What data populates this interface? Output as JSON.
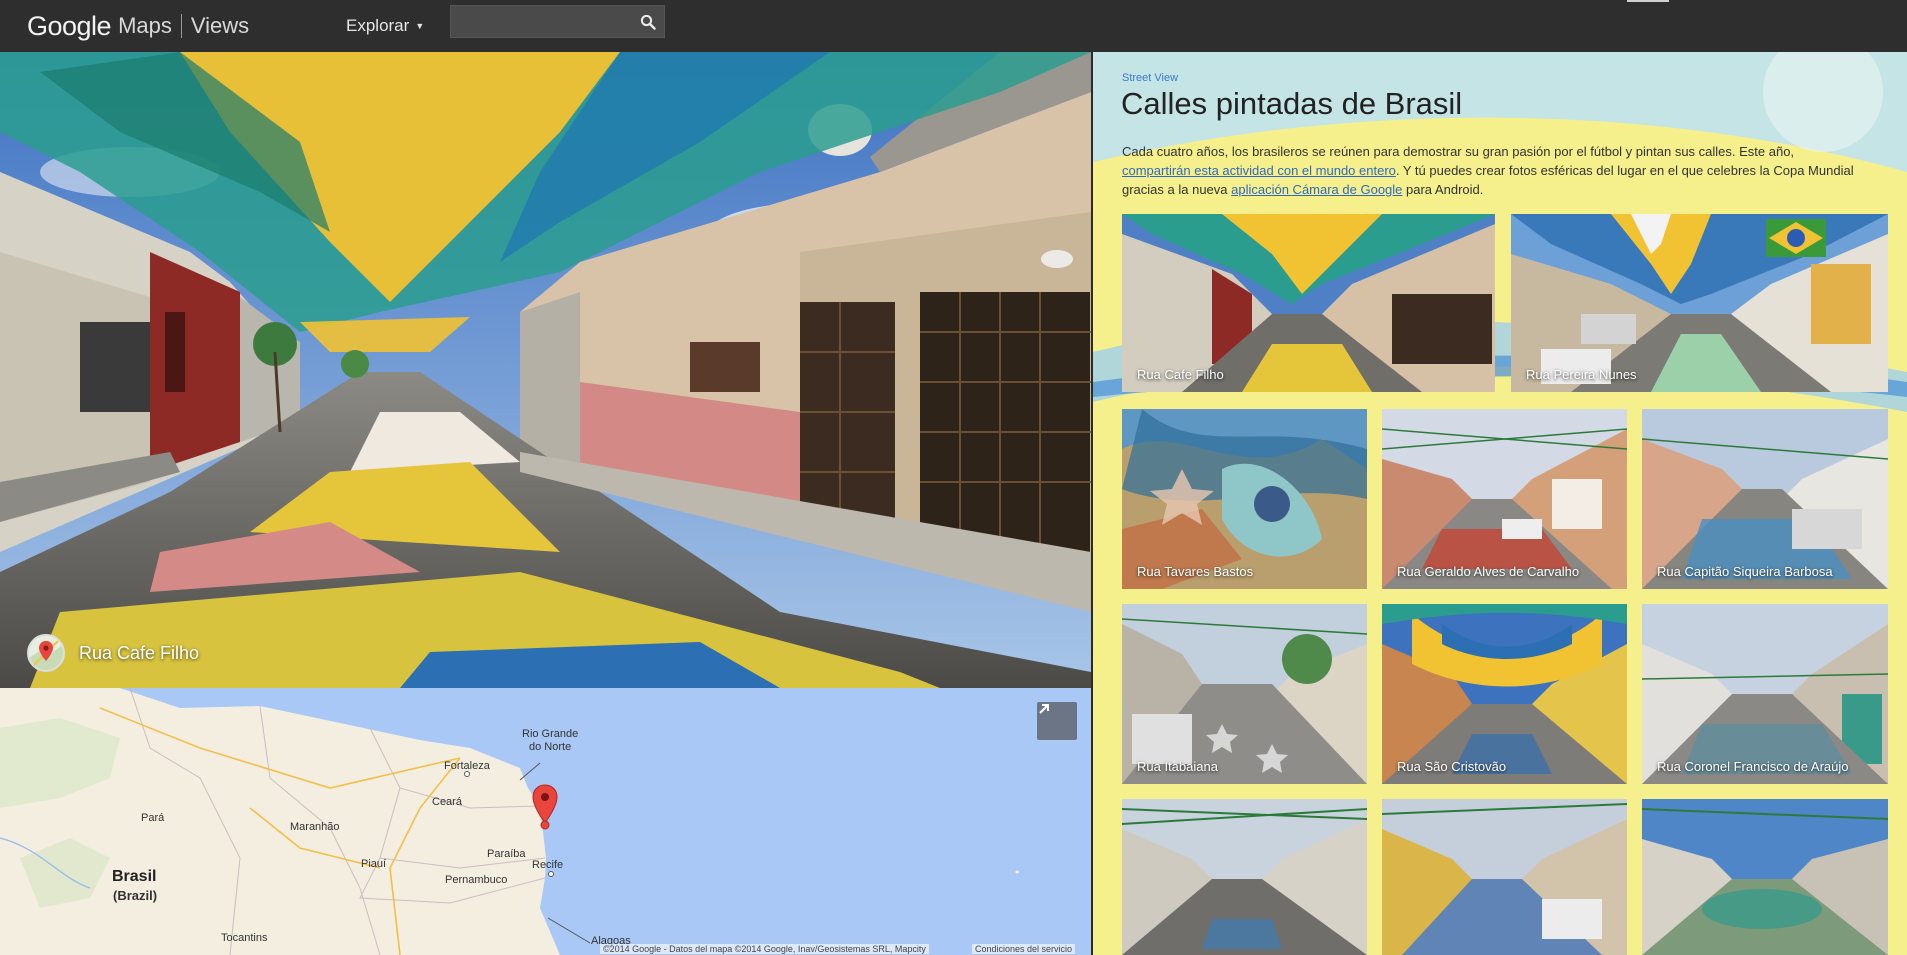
{
  "app": {
    "brand_google": "Google",
    "brand_maps": "Maps",
    "brand_views": "Views",
    "explore_label": "Explorar",
    "search_placeholder": ""
  },
  "pano": {
    "location_label": "Rua Cafe Filho"
  },
  "map": {
    "labels": {
      "rio_grande": "Rio Grande",
      "do_norte": "do Norte",
      "fortaleza": "Fortaleza",
      "ceara": "Ceará",
      "para": "Pará",
      "maranhao": "Maranhão",
      "piaui": "Piauí",
      "paraiba": "Paraíba",
      "recife": "Recife",
      "pernambuco": "Pernambuco",
      "brasil": "Brasil",
      "brazil": "(Brazil)",
      "tocantins": "Tocantins",
      "alagoas": "Alagoas"
    },
    "copyright": "©2014 Google - Datos del mapa ©2014 Google, Inav/Geosistemas SRL, Mapcity",
    "terms": "Condiciones del servicio"
  },
  "panel": {
    "section_label": "Street View",
    "title": "Calles pintadas de Brasil",
    "desc_part1": "Cada cuatro años, los brasileros se reúnen para demostrar su gran pasión por el fútbol y pintan sus calles. Este año, ",
    "desc_link1": "compartirán esta actividad con el mundo entero",
    "desc_part2": ". Y tú puedes crear fotos esféricas del lugar en el que celebres la Copa Mundial gracias a la nueva ",
    "desc_link2": "aplicación Cámara de Google",
    "desc_part3": " para Android."
  },
  "tiles": [
    {
      "label": "Rua Cafe Filho"
    },
    {
      "label": "Rua Pereira Nunes"
    },
    {
      "label": "Rua Tavares Bastos"
    },
    {
      "label": "Rua Geraldo Alves de Carvalho"
    },
    {
      "label": "Rua Capitão Siqueira Barbosa"
    },
    {
      "label": "Rua Itabaiana"
    },
    {
      "label": "Rua São Cristovão"
    },
    {
      "label": "Rua Coronel Francisco de Araújo"
    },
    {
      "label": ""
    },
    {
      "label": ""
    },
    {
      "label": ""
    }
  ],
  "colors": {
    "topbar": "#2e2e2e",
    "panel_yellow": "#f5ef8c",
    "link_blue": "#2f6ac0",
    "map_water": "#a9c8f5",
    "marker_red": "#e8453c"
  }
}
